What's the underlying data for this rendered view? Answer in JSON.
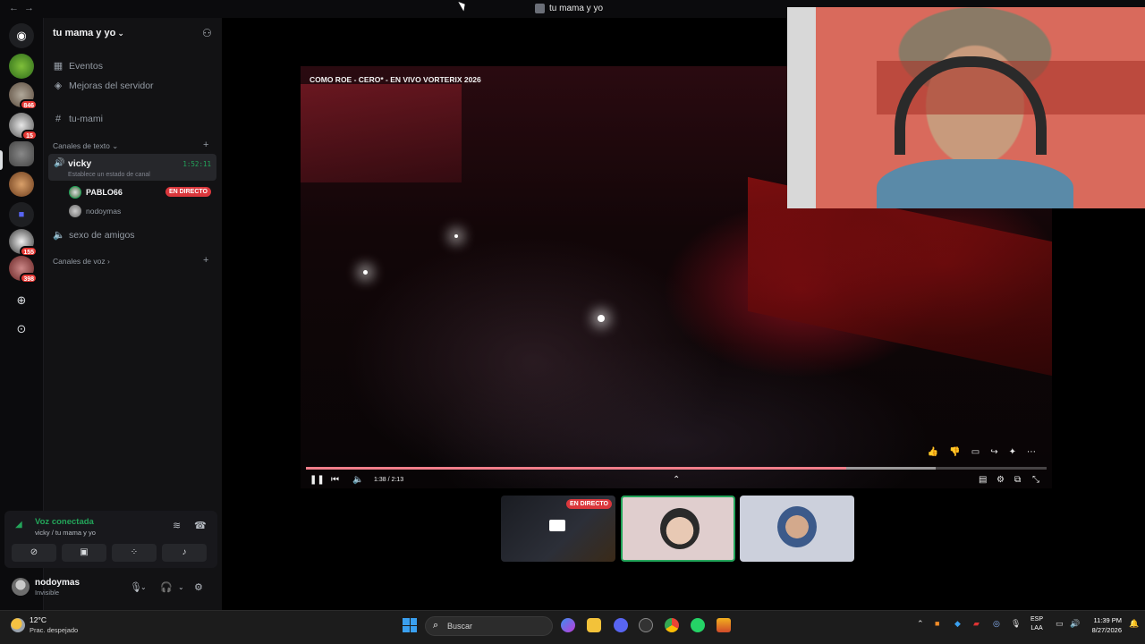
{
  "window": {
    "title": "tu mama y yo"
  },
  "rail": {
    "badges": [
      "846",
      "15",
      "155",
      "398"
    ]
  },
  "server": {
    "name": "tu mama y yo",
    "top_items": [
      "Eventos",
      "Mejoras del servidor"
    ],
    "text_channel": "tu-mami",
    "category_text": "Canales de texto",
    "voice_channel": {
      "name": "vicky",
      "status": "Establece un estado de canal",
      "timer": "1:52:11",
      "users": [
        {
          "name": "PABLO66",
          "live": "EN DIRECTO"
        },
        {
          "name": "nodoymas"
        }
      ]
    },
    "voice_channel_2": "sexo de amigos",
    "category_voice": "Canales de voz"
  },
  "voice_panel": {
    "title": "Voz conectada",
    "subtitle": "vicky / tu mama y yo"
  },
  "user": {
    "name": "nodoymas",
    "status": "Invisible"
  },
  "stream": {
    "video_title": "COMO ROE - CERO* - EN VIVO VORTERIX 2026",
    "time": "1:38 / 2:13",
    "progress": 0.73,
    "buffered": 0.85
  },
  "tiles": {
    "live_tag": "EN DIRECTO"
  },
  "taskbar": {
    "temperature": "12°C",
    "weather": "Prac. despejado",
    "search_placeholder": "Buscar",
    "lang_1": "ESP",
    "lang_2": "LAA",
    "time": "11:39 PM",
    "date": "8/27/2026"
  },
  "colors": {
    "accent_green": "#23a55a",
    "live_red": "#da373c",
    "progress_red": "#e5142a"
  }
}
